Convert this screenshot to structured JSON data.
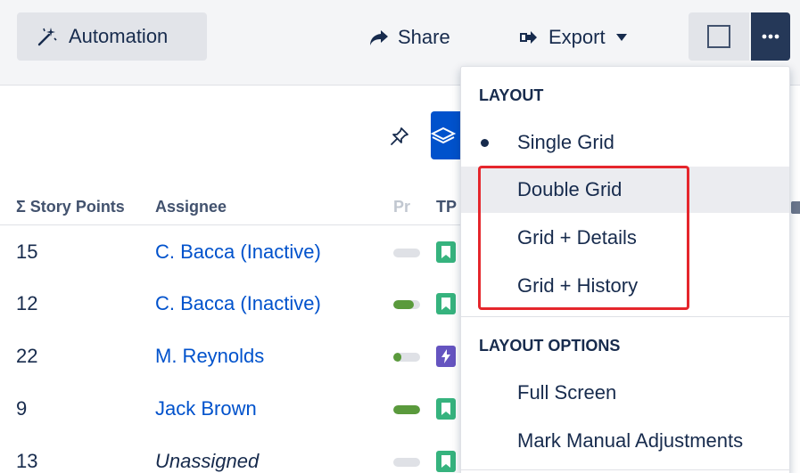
{
  "toolbar": {
    "automation_label": "Automation",
    "share_label": "Share",
    "export_label": "Export"
  },
  "grid": {
    "headers": {
      "story_points": "Σ Story Points",
      "assignee": "Assignee",
      "progress": "Pr",
      "tp": "TP"
    },
    "rows": [
      {
        "story_points": "15",
        "assignee": "C. Bacca (Inactive)",
        "progress": 0.0,
        "icon": "story-icon",
        "icon_color": "#36b37e"
      },
      {
        "story_points": "12",
        "assignee": "C. Bacca (Inactive)",
        "progress": 0.75,
        "icon": "story-icon",
        "icon_color": "#36b37e"
      },
      {
        "story_points": "22",
        "assignee": "M. Reynolds",
        "progress": 0.3,
        "icon": "epic-icon",
        "icon_color": "#6554c0"
      },
      {
        "story_points": "9",
        "assignee": "Jack Brown",
        "progress": 1.0,
        "icon": "story-icon",
        "icon_color": "#36b37e"
      },
      {
        "story_points": "13",
        "assignee": "Unassigned",
        "progress": 0.0,
        "icon": "story-icon",
        "icon_color": "#36b37e"
      }
    ]
  },
  "dropdown": {
    "layout_heading": "LAYOUT",
    "layout_items": [
      {
        "label": "Single Grid",
        "selected": true
      },
      {
        "label": "Double Grid",
        "selected": false
      },
      {
        "label": "Grid + Details",
        "selected": false
      },
      {
        "label": "Grid + History",
        "selected": false
      }
    ],
    "options_heading": "LAYOUT OPTIONS",
    "option_items": [
      {
        "label": "Full Screen"
      },
      {
        "label": "Mark Manual Adjustments"
      }
    ]
  },
  "colors": {
    "accent": "#0052cc",
    "more_button": "#253858",
    "highlight_box": "#e5262c",
    "progress_fill": "#5a9a3c"
  }
}
